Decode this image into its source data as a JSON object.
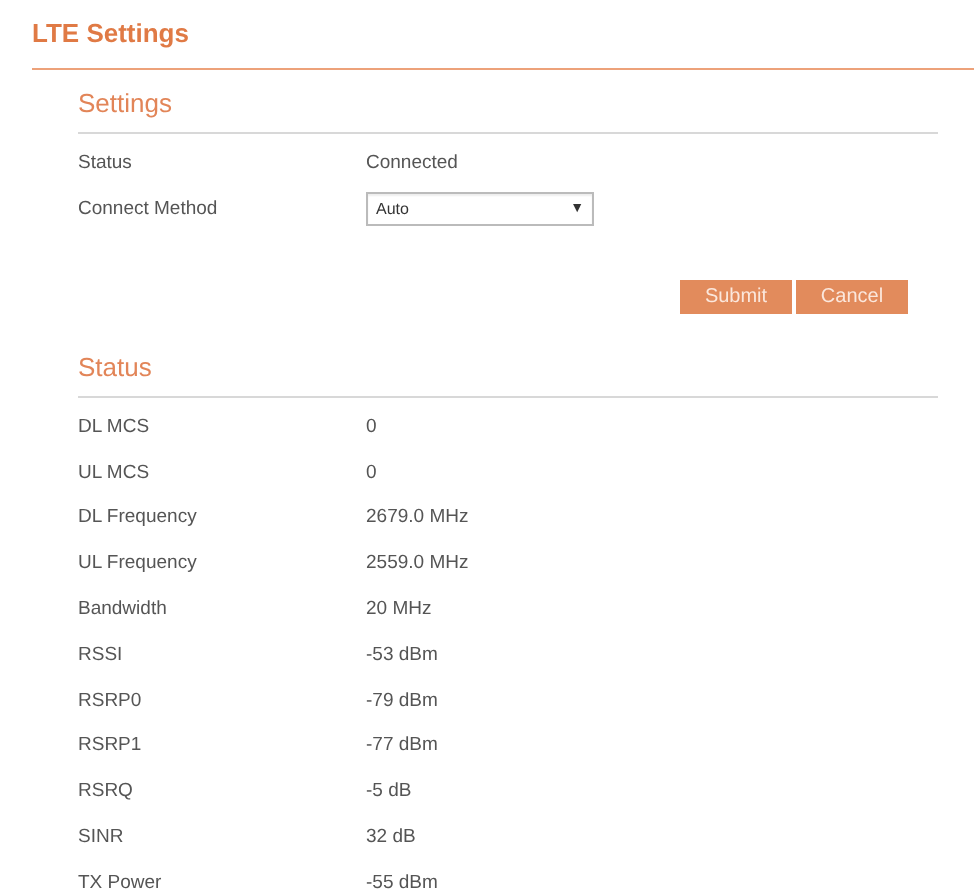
{
  "page_title": "LTE Settings",
  "settings": {
    "heading": "Settings",
    "rows": [
      {
        "kind": "text",
        "label": "Status",
        "value": "Connected"
      },
      {
        "kind": "select",
        "label": "Connect Method",
        "value": "Auto",
        "arrow": "▼"
      }
    ],
    "buttons": [
      {
        "label": "Submit"
      },
      {
        "label": "Cancel"
      }
    ]
  },
  "status": {
    "heading": "Status",
    "rows": [
      {
        "label": "DL MCS",
        "value": "0"
      },
      {
        "label": "UL MCS",
        "value": "0"
      },
      {
        "label": "DL Frequency",
        "value": "2679.0 MHz"
      },
      {
        "label": "UL Frequency",
        "value": "2559.0 MHz"
      },
      {
        "label": "Bandwidth",
        "value": "20 MHz"
      },
      {
        "label": "RSSI",
        "value": "-53 dBm"
      },
      {
        "label": "RSRP0",
        "value": "-79 dBm"
      },
      {
        "label": "RSRP1",
        "value": "-77 dBm"
      },
      {
        "label": "RSRQ",
        "value": "-5 dB"
      },
      {
        "label": "SINR",
        "value": "32 dB"
      },
      {
        "label": "TX Power",
        "value": "-55 dBm"
      }
    ]
  }
}
